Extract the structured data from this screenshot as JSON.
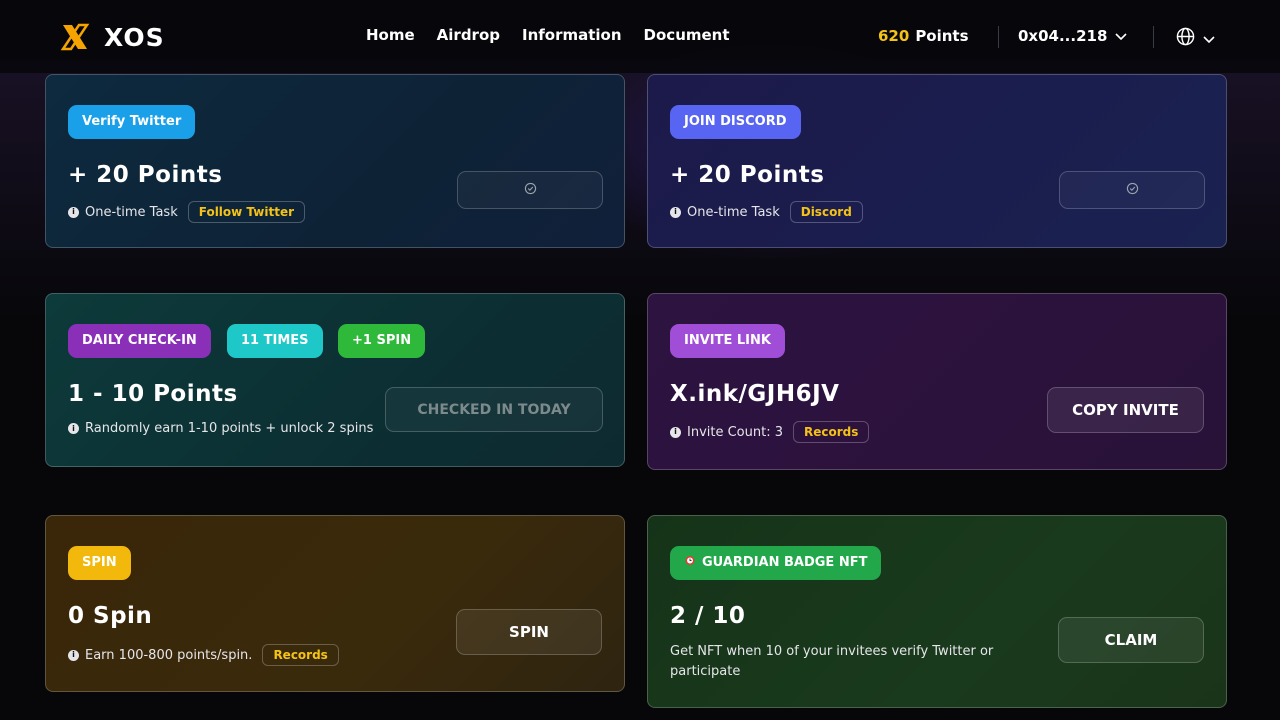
{
  "brand": {
    "name": "XOS"
  },
  "nav": {
    "items": [
      "Home",
      "Airdrop",
      "Information",
      "Document"
    ]
  },
  "header": {
    "points_value": "620",
    "points_label": "Points",
    "wallet": "0x04...218"
  },
  "cards": {
    "twitter": {
      "tag": "Verify Twitter",
      "title": "+ 20 Points",
      "desc": "One-time Task",
      "link": "Follow Twitter"
    },
    "discord": {
      "tag": "JOIN DISCORD",
      "title": "+ 20 Points",
      "desc": "One-time Task",
      "link": "Discord"
    },
    "checkin": {
      "tags": [
        "DAILY CHECK-IN",
        "11 TIMES",
        "+1 SPIN"
      ],
      "title": "1 - 10 Points",
      "desc": "Randomly earn 1-10 points + unlock 2 spins",
      "button": "CHECKED IN TODAY"
    },
    "invite": {
      "tag": "INVITE LINK",
      "title": "X.ink/GJH6JV",
      "desc": "Invite Count: 3",
      "link": "Records",
      "button": "COPY INVITE"
    },
    "spin": {
      "tag": "SPIN",
      "title": "0 Spin",
      "desc": "Earn 100-800 points/spin.",
      "link": "Records",
      "button": "SPIN"
    },
    "nft": {
      "tag": "GUARDIAN BADGE NFT",
      "title": "2 / 10",
      "desc": "Get NFT when 10 of your invitees verify Twitter or participate",
      "button": "CLAIM"
    }
  },
  "colors": {
    "accent": "#f5c318",
    "twitter": "#1aa0e8",
    "discord": "#5865f2",
    "purple": "#8a2fb8",
    "cyan": "#1fc8c8",
    "green": "#2fb93a",
    "yellow": "#f2b90c",
    "nft_green": "#22a84a"
  }
}
